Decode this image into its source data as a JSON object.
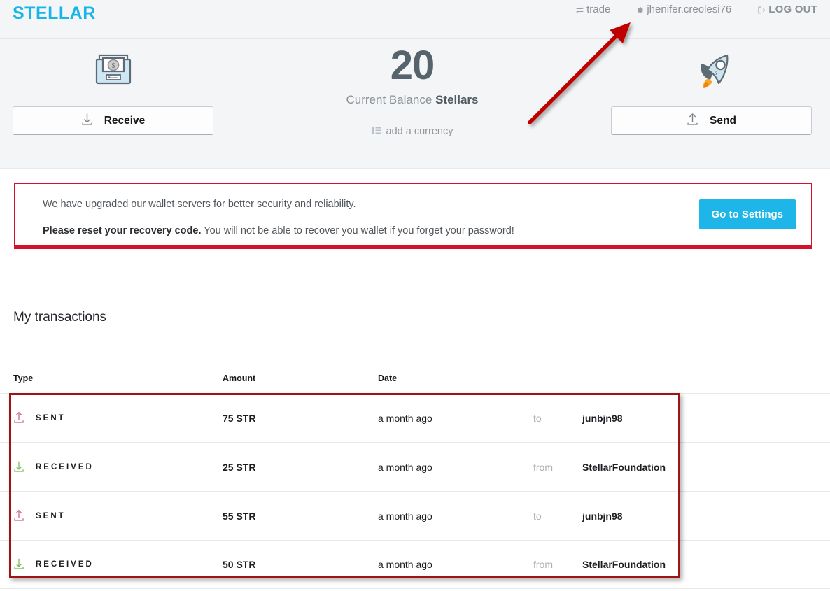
{
  "header": {
    "brand": "STELLAR",
    "nav": [
      {
        "label": "trade",
        "icon": "exchange-icon"
      },
      {
        "label": "jhenifer.creolesi76",
        "icon": "gear-icon"
      },
      {
        "label": "LOG OUT",
        "icon": "logout-icon"
      }
    ]
  },
  "hero": {
    "receive": {
      "label": "Receive",
      "icon": "download-arrow-icon",
      "art": "atm-cash-dispenser-icon"
    },
    "send": {
      "label": "Send",
      "icon": "upload-arrow-icon",
      "art": "rocket-icon"
    },
    "balance": {
      "amount": "20",
      "label_prefix": "Current Balance ",
      "label_unit": "Stellars",
      "add_currency": "add a currency",
      "add_currency_icon": "list-bars-icon"
    }
  },
  "alert": {
    "line1": "We have upgraded our wallet servers for better security and reliability.",
    "line2_bold": "Please reset your recovery code.",
    "line2_rest": " You will not be able to recover you wallet if you forget your password!",
    "button": "Go to Settings",
    "accent_color": "#d4122c",
    "button_color": "#1eb6e8"
  },
  "transactions": {
    "title": "My transactions",
    "columns": {
      "type": "Type",
      "amount": "Amount",
      "date": "Date"
    },
    "rows": [
      {
        "type": "SENT",
        "icon": "arrow-up-out-icon",
        "amount": "75 STR",
        "date": "a month ago",
        "preposition": "to",
        "party": "junbjn98"
      },
      {
        "type": "RECEIVED",
        "icon": "arrow-down-in-icon",
        "amount": "25 STR",
        "date": "a month ago",
        "preposition": "from",
        "party": "StellarFoundation"
      },
      {
        "type": "SENT",
        "icon": "arrow-up-out-icon",
        "amount": "55 STR",
        "date": "a month ago",
        "preposition": "to",
        "party": "junbjn98"
      },
      {
        "type": "RECEIVED",
        "icon": "arrow-down-in-icon",
        "amount": "50 STR",
        "date": "a month ago",
        "preposition": "from",
        "party": "StellarFoundation"
      }
    ]
  },
  "annotations": {
    "arrow_color": "#c00000",
    "box_color": "#9e1414"
  }
}
